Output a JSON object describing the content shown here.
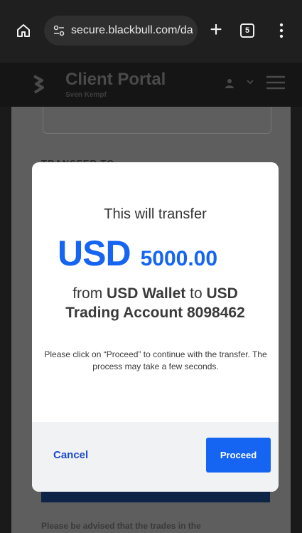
{
  "browser": {
    "url": "secure.blackbull.com/da",
    "tab_count": "5",
    "new_tab_symbol": "+"
  },
  "portal": {
    "title": "Client Portal",
    "user_name": "Sven Kempf",
    "section_label": "TRANSFER TO",
    "advisory_text": "Please be advised that the trades in the"
  },
  "modal": {
    "lead": "This will transfer",
    "currency": "USD",
    "amount": "5000.00",
    "from_prefix": "from",
    "from_account": "USD Wallet",
    "to_word": "to",
    "to_currency": "USD",
    "to_account": "Trading Account 8098462",
    "note": "Please click on “Proceed” to continue with the transfer. The process may take a few seconds.",
    "cancel_label": "Cancel",
    "proceed_label": "Proceed"
  },
  "colors": {
    "accent": "#1565f2",
    "cancel_text": "#1d4cc9",
    "footer_bg": "#f1f2f4"
  },
  "icons": [
    "home-icon",
    "site-settings-icon",
    "new-tab-icon",
    "tab-switcher-icon",
    "more-menu-icon",
    "blackbull-logo-icon",
    "user-icon",
    "chevron-down-icon",
    "hamburger-menu-icon"
  ]
}
